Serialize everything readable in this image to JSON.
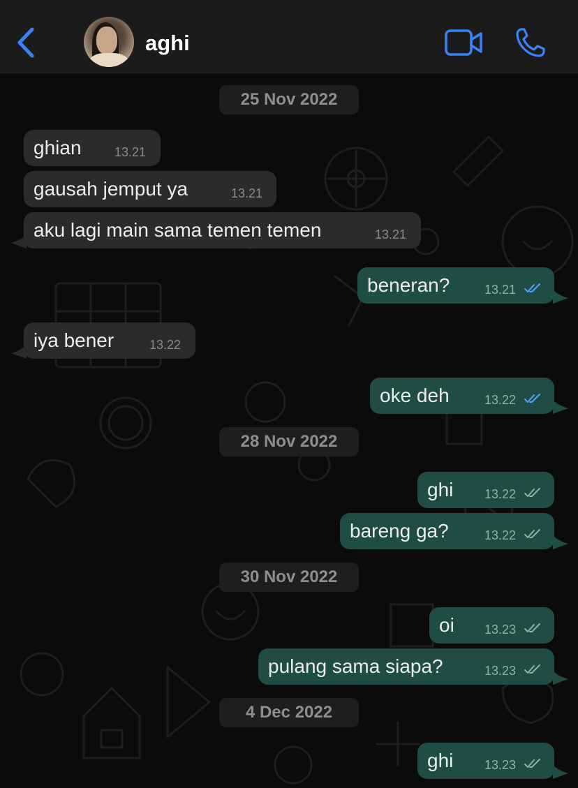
{
  "header": {
    "contact_name": "aghi"
  },
  "dates": [
    "25 Nov 2022",
    "28 Nov 2022",
    "30 Nov 2022",
    "4 Dec 2022"
  ],
  "messages": [
    {
      "text": "ghian",
      "time": "13.21",
      "dir": "in"
    },
    {
      "text": "gausah jemput ya",
      "time": "13.21",
      "dir": "in"
    },
    {
      "text": "aku lagi main sama temen temen",
      "time": "13.21",
      "dir": "in"
    },
    {
      "text": "beneran?",
      "time": "13.21",
      "dir": "out",
      "status": "read"
    },
    {
      "text": "iya bener",
      "time": "13.22",
      "dir": "in"
    },
    {
      "text": "oke deh",
      "time": "13.22",
      "dir": "out",
      "status": "read"
    },
    {
      "text": "ghi",
      "time": "13.22",
      "dir": "out",
      "status": "delivered"
    },
    {
      "text": "bareng ga?",
      "time": "13.22",
      "dir": "out",
      "status": "delivered"
    },
    {
      "text": "oi",
      "time": "13.23",
      "dir": "out",
      "status": "delivered"
    },
    {
      "text": "pulang sama siapa?",
      "time": "13.23",
      "dir": "out",
      "status": "delivered"
    },
    {
      "text": "ghi",
      "time": "13.23",
      "dir": "out",
      "status": "delivered"
    }
  ],
  "icons": {
    "back": "chevron-left-icon",
    "video": "video-camera-icon",
    "call": "phone-icon",
    "read_ticks": "double-check-blue-icon",
    "delivered_ticks": "double-check-grey-icon"
  },
  "colors": {
    "accent": "#3b82f6",
    "incoming_bubble": "#2b2b2d",
    "outgoing_bubble": "#1f4d45",
    "read_tick": "#4fa3f7",
    "delivered_tick": "#8fb0a9"
  }
}
